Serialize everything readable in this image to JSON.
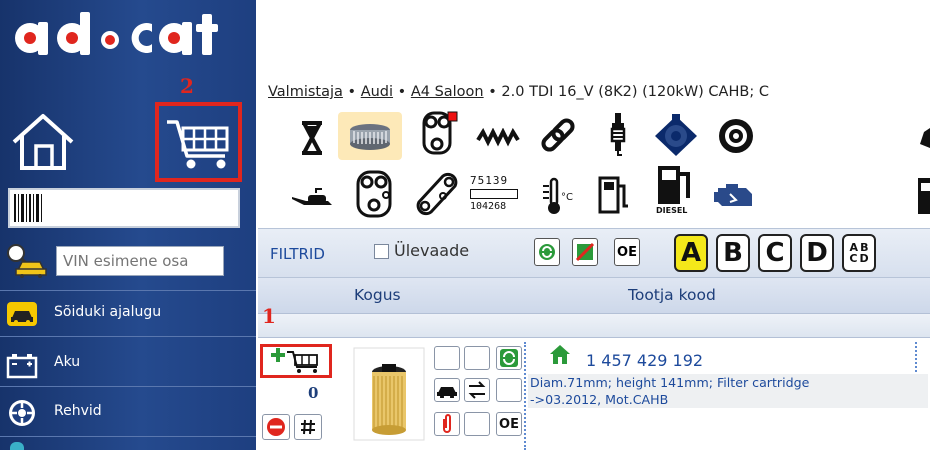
{
  "colors": {
    "sidebar": "#1e3f80",
    "accent_red": "#e0261e",
    "active_letter": "#f4e81a",
    "link_blue": "#1d4a9c"
  },
  "logo": {
    "text": "ad·cat"
  },
  "annotations": {
    "cart_marker": "2",
    "add_marker": "1"
  },
  "sidebar": {
    "vin_placeholder": "VIN esimene osa",
    "items": [
      {
        "label": "Sõiduki ajalugu",
        "icon": "car-history-icon"
      },
      {
        "label": "Aku",
        "icon": "battery-icon"
      },
      {
        "label": "Rehvid",
        "icon": "tire-icon"
      }
    ]
  },
  "breadcrumb": {
    "manufacturer": "Valmistaja",
    "make": "Audi",
    "model": "A4 Saloon",
    "engine": "2.0 TDI 16_V (8K2) (120kW) CAHB; C",
    "sep": " • "
  },
  "category_icons": [
    "hourglass-icon",
    "air-filter-icon",
    "timing-icon",
    "spring-icon",
    "chain-icon",
    "spark-plug-icon",
    "clutch-icon",
    "turbo-icon",
    "oil-can-icon",
    "timing-belt-icon",
    "belt-icon",
    "number-badge-icon",
    "temperature-icon",
    "fuel-pump-icon",
    "diesel-pump-icon",
    "engine-icon"
  ],
  "category_number_text": {
    "top": "75139",
    "bottom": "104268"
  },
  "diesel_label": "DIESEL",
  "filter_bar": {
    "filter_label": "FILTRID",
    "overview_label": "Ülevaade",
    "oe_label": "OE",
    "letters": [
      "A",
      "B",
      "C",
      "D"
    ],
    "last_letters": [
      "A",
      "B",
      "C",
      "D"
    ]
  },
  "table": {
    "headers": {
      "quantity": "Kogus",
      "mfr_code": "Tootja kood"
    }
  },
  "product": {
    "quantity": "0",
    "code": "1 457 429 192",
    "desc_line1": "Diam.71mm; height 141mm; Filter cartridge",
    "desc_line2": "->03.2012, Mot.CAHB",
    "oe_label": "OE"
  }
}
